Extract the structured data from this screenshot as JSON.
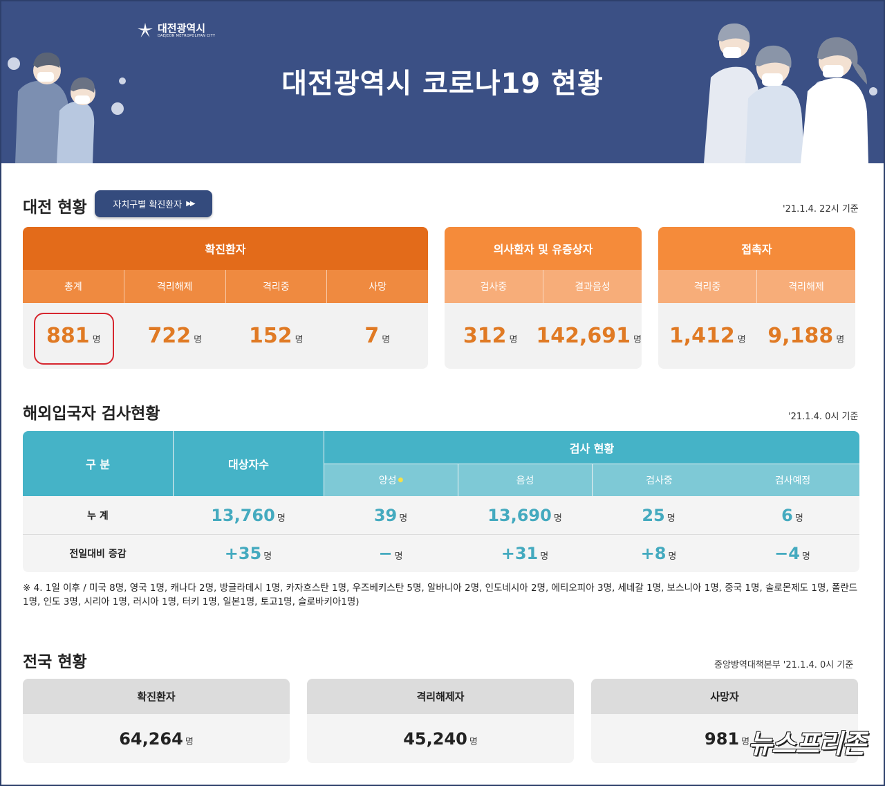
{
  "header": {
    "logo_ko": "대전광역시",
    "logo_en": "DAEJEON METROPOLITAN CITY",
    "title": "대전광역시 코로나19 현황"
  },
  "daejeon": {
    "title": "대전 현황",
    "region_button": "자치구별 확진환자",
    "date": "'21.1.4. 22시 기준",
    "unit": "명",
    "confirmed": {
      "head": "확진환자",
      "labels": [
        "총계",
        "격리해제",
        "격리중",
        "사망"
      ],
      "values": [
        "881",
        "722",
        "152",
        "7"
      ]
    },
    "suspected": {
      "head": "의사환자 및 유증상자",
      "labels": [
        "검사중",
        "결과음성"
      ],
      "values": [
        "312",
        "142,691"
      ]
    },
    "contacts": {
      "head": "접촉자",
      "labels": [
        "격리중",
        "격리해제"
      ],
      "values": [
        "1,412",
        "9,188"
      ]
    }
  },
  "overseas": {
    "title": "해외입국자 검사현황",
    "date": "'21.1.4. 0시 기준",
    "col_gubun": "구 분",
    "col_target": "대상자수",
    "col_test": "검사 현황",
    "sub_cols": [
      "양성",
      "음성",
      "검사중",
      "검사예정"
    ],
    "positive_star": "●",
    "unit": "명",
    "rows": [
      {
        "label": "누 계",
        "target": "13,760",
        "values": [
          "39",
          "13,690",
          "25",
          "6"
        ]
      },
      {
        "label": "전일대비 증감",
        "target": "+35",
        "values": [
          "−",
          "+31",
          "+8",
          "−4"
        ]
      }
    ],
    "footnote": "※ 4. 1일 이후 / 미국 8명, 영국 1명, 캐나다 2명, 방글라데시 1명, 카자흐스탄 1명, 우즈베키스탄 5명, 알바니아 2명, 인도네시아 2명, 에티오피아 3명, 세네갈 1명, 보스니아 1명, 중국 1명, 솔로몬제도 1명, 폴란드 1명, 인도 3명, 시리아 1명, 러시아 1명, 터키 1명, 일본1명, 토고1명, 슬로바키아1명)"
  },
  "national": {
    "title": "전국 현황",
    "date": "중앙방역대책본부 '21.1.4. 0시 기준",
    "unit": "명",
    "cards": [
      {
        "label": "확진환자",
        "value": "64,264"
      },
      {
        "label": "격리해제자",
        "value": "45,240"
      },
      {
        "label": "사망자",
        "value": "981"
      }
    ]
  },
  "watermark": "뉴스프리존",
  "colors": {
    "banner": "#3b5085",
    "confirmed_head": "#e36b1a",
    "orange_number": "#e07a24",
    "teal_head": "#45b3c7",
    "teal_number": "#44aabf",
    "highlight_circle": "#d6262f"
  }
}
